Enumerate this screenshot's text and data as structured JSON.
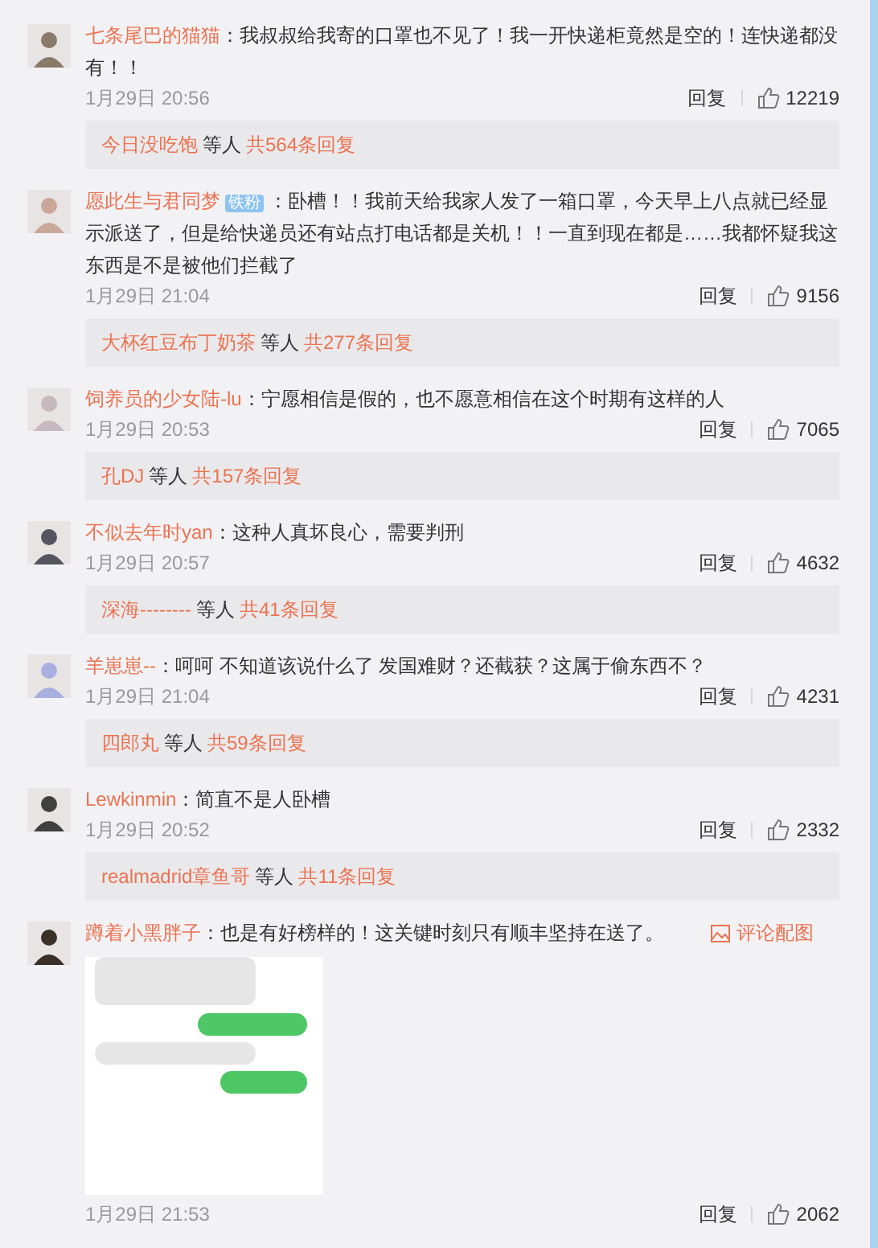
{
  "comments": [
    {
      "user": "七条尾巴的猫猫",
      "text": "：我叔叔给我寄的口罩也不见了！我一开快递柜竟然是空的！连快递都没有！！",
      "time": "1月29日 20:56",
      "reply": "回复",
      "likes": "12219",
      "replies": {
        "names": "今日没吃饱",
        "middle": "等人",
        "count": "共564条回复"
      }
    },
    {
      "user": "愿此生与君同梦",
      "badge": "铁粉",
      "text": "：卧槽！！我前天给我家人发了一箱口罩，今天早上八点就已经显示派送了，但是给快递员还有站点打电话都是关机！！一直到现在都是……我都怀疑我这东西是不是被他们拦截了",
      "time": "1月29日 21:04",
      "reply": "回复",
      "likes": "9156",
      "replies": {
        "names": "大杯红豆布丁奶茶",
        "middle": "等人",
        "count": "共277条回复"
      }
    },
    {
      "user": "饲养员的少女陆-lu",
      "text": "：宁愿相信是假的，也不愿意相信在这个时期有这样的人",
      "time": "1月29日 20:53",
      "reply": "回复",
      "likes": "7065",
      "replies": {
        "names": "孔DJ",
        "middle": "等人",
        "count": "共157条回复"
      }
    },
    {
      "user": "不似去年时yan",
      "text": "：这种人真坏良心，需要判刑",
      "time": "1月29日 20:57",
      "reply": "回复",
      "likes": "4632",
      "replies": {
        "names": "深海--------",
        "middle": "等人",
        "count": "共41条回复"
      }
    },
    {
      "user": "羊崽崽--",
      "text": "：呵呵 不知道该说什么了 发国难财？还截获？这属于偷东西不？",
      "time": "1月29日 21:04",
      "reply": "回复",
      "likes": "4231",
      "replies": {
        "names": "四郎丸",
        "middle": "等人",
        "count": "共59条回复"
      }
    },
    {
      "user": "Lewkinmin",
      "text": "：简直不是人卧槽",
      "time": "1月29日 20:52",
      "reply": "回复",
      "likes": "2332",
      "replies": {
        "names": "realmadrid章鱼哥",
        "middle": "等人",
        "count": "共11条回复"
      }
    },
    {
      "user": "蹲着小黑胖子",
      "text": "：也是有好榜样的！这关键时刻只有顺丰坚持在送了。",
      "image_link": "评论配图",
      "time": "1月29日 21:53",
      "reply": "回复",
      "likes": "2062"
    }
  ]
}
